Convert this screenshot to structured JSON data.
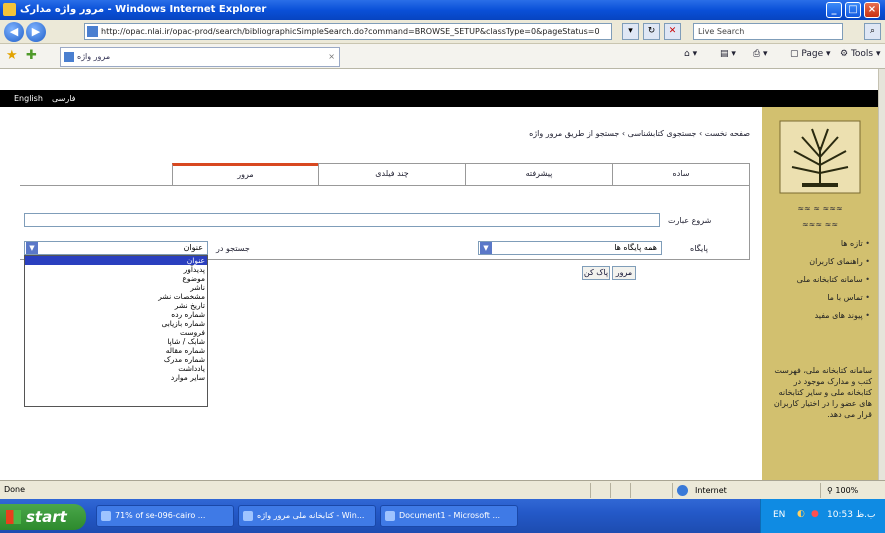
{
  "window": {
    "title": "مرور واژه مدارک - Windows Internet Explorer",
    "buttons": {
      "minimize": "_",
      "maximize": "□",
      "close": "×"
    }
  },
  "address_bar": {
    "url": "http://opac.nlai.ir/opac-prod/search/bibliographicSimpleSearch.do?command=BROWSE_SETUP&classType=0&pageStatus=0",
    "live_search_placeholder": "Live Search"
  },
  "tab": {
    "label": "مرور واژه"
  },
  "command_bar": {
    "page_label": "Page",
    "tools_label": "Tools"
  },
  "page": {
    "top_links": {
      "english": "English",
      "home": "فارسی"
    },
    "breadcrumb": "صفحه نخست › جستجوی کتابشناسی › جستجو از طریق مرور واژه",
    "tabs": [
      "ساده",
      "پیشرفته",
      "چند فیلدی",
      "مرور"
    ],
    "active_tab_index": 3,
    "start_phrase_label": "شروع عبارت",
    "database_label": "پایگاه",
    "database_value": "همه پایگاه ها",
    "search_in_label": "جستجو در",
    "search_in_value": "عنوان",
    "browse_button": "مرور",
    "clear_button": "پاک کن",
    "dropdown_options": [
      "عنوان",
      "پدیدآور",
      "موضوع",
      "ناشر",
      "مشخصات نشر",
      "تاریخ نشر",
      "شماره رده",
      "شماره بازیابی",
      "فروست",
      "شابک / شاپا",
      "شماره مقاله",
      "شماره مدرک",
      "یادداشت",
      "سایر موارد"
    ],
    "dropdown_selected_index": 0
  },
  "sidebar": {
    "logo_text": "سازمان اسناد و کتابخانه ملی جمهوری اسلامی ایران",
    "links": [
      "تازه ها",
      "راهنمای کاربران",
      "سامانه کتابخانه ملی",
      "تماس با ما",
      "پیوند های مفید"
    ],
    "blurb": "سامانه کتابخانه ملی، فهرست کتب و مدارک موجود در کتابخانه ملی و سایر کتابخانه های عضو را در اختیار کاربران قرار می دهد."
  },
  "status_bar": {
    "left": "Done",
    "zone": "Internet",
    "zoom": "100%"
  },
  "taskbar": {
    "start": "start",
    "tasks": [
      "71% of se-096-cairo ...",
      "کتابخانه ملی مرور واژه - Win...",
      "Document1 - Microsoft ..."
    ],
    "tray_lang": "EN",
    "clock": "10:53 ب.ظ"
  }
}
